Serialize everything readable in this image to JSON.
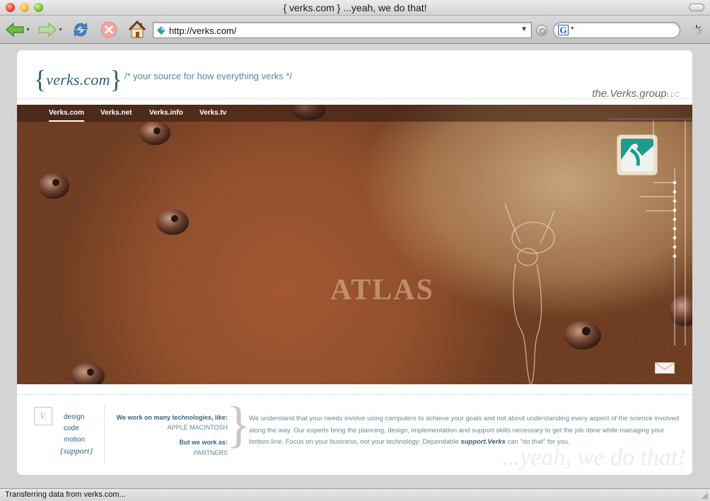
{
  "window": {
    "title": "{ verks.com } ...yeah, we do that!"
  },
  "toolbar": {
    "url": "http://verks.com/",
    "icons": [
      "back-arrow-icon",
      "forward-arrow-icon",
      "reload-icon",
      "stop-icon",
      "home-icon",
      "site-favicon-icon",
      "go-icon",
      "google-search-icon",
      "loading-spinner-icon"
    ]
  },
  "page": {
    "logo": {
      "open": "{",
      "text": "verks.com",
      "close": "}"
    },
    "tagline": "/* your source for how everything verks */",
    "group": {
      "name": "the.Verks.group",
      "suffix": "LLC"
    },
    "nav": [
      "Verks.com",
      "Verks.net",
      "Verks.info",
      "Verks.tv"
    ],
    "nav_active": "Verks.com",
    "hero_word": "ATLAS",
    "footer": {
      "v_mark": "V.",
      "services": [
        "design",
        "code",
        "motion"
      ],
      "support": "{support}",
      "tech_heading": "We work on many technologies, like:",
      "tech_value": "APPLE MACINTOSH",
      "work_heading": "But we work as:",
      "work_value": "PARTNERS",
      "brace": "}",
      "description_part1": "We understand that your needs involve using computers to achieve your goals and not about understanding every aspect of the science involved along the way.  Our experts bring the planning, design, implementation and support skills necessary to get the job done while managing your bottom line.  Focus on your business, not your technology: Dependable ",
      "description_emphasis": "support.Verks",
      "description_part2": " can \"do that\" for you.",
      "slogan": "...yeah, we do that!"
    }
  },
  "status": {
    "text": "Transferring data from verks.com..."
  },
  "colors": {
    "accent": "#2f5f72",
    "hero_rust": "#8b4526",
    "badge_teal": "#1e9c8e"
  }
}
